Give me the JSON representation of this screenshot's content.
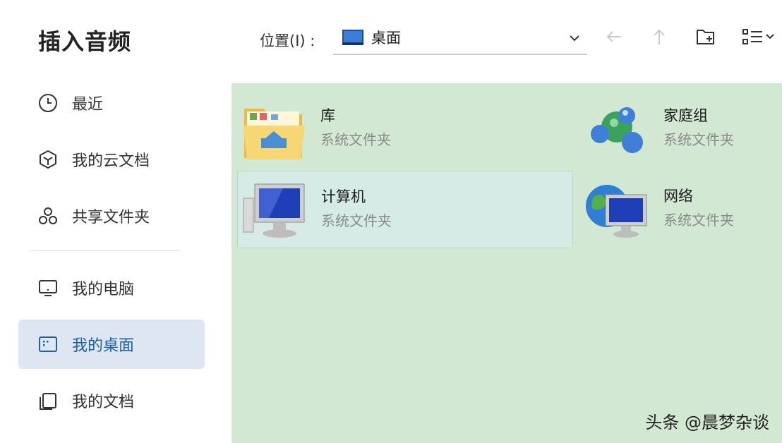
{
  "dialog": {
    "title": "插入音频"
  },
  "sidebar": {
    "items": [
      {
        "label": "最近",
        "icon": "clock-icon"
      },
      {
        "label": "我的云文档",
        "icon": "cloud-doc-icon"
      },
      {
        "label": "共享文件夹",
        "icon": "shared-folder-icon"
      },
      {
        "label": "我的电脑",
        "icon": "monitor-icon"
      },
      {
        "label": "我的桌面",
        "icon": "desktop-icon",
        "active": true
      },
      {
        "label": "我的文档",
        "icon": "documents-icon"
      }
    ]
  },
  "toolbar": {
    "location_label": "位置(I) :",
    "location_value": "桌面",
    "buttons": [
      "back-icon",
      "up-icon",
      "new-folder-icon",
      "view-options-icon"
    ]
  },
  "files": [
    {
      "name": "库",
      "type": "系统文件夹",
      "icon": "library-folder-icon"
    },
    {
      "name": "家庭组",
      "type": "系统文件夹",
      "icon": "homegroup-icon"
    },
    {
      "name": "计算机",
      "type": "系统文件夹",
      "icon": "computer-icon",
      "selected": true
    },
    {
      "name": "网络",
      "type": "系统文件夹",
      "icon": "network-icon"
    }
  ],
  "watermark": "头条 @晨梦杂谈",
  "colors": {
    "accent": "#1f5fa8",
    "content_bg": "#d3e8d3",
    "active_nav_bg": "#dde6f1"
  }
}
